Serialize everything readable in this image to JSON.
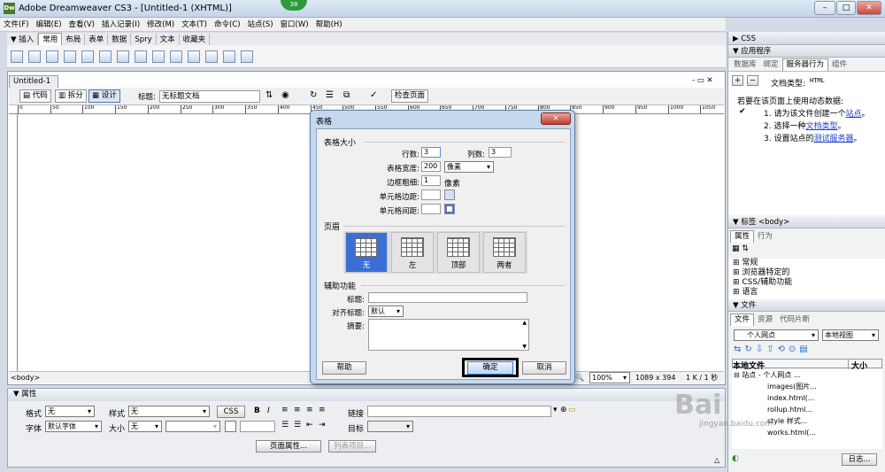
{
  "window": {
    "title": "Adobe Dreamweaver CS3 - [Untitled-1 (XHTML)]",
    "app_icon": "Dw",
    "badge": "38",
    "min_label": "–",
    "max_label": "□",
    "close_label": "✕"
  },
  "menubar": [
    "文件(F)",
    "编辑(E)",
    "查看(V)",
    "插入记录(I)",
    "修改(M)",
    "文本(T)",
    "命令(C)",
    "站点(S)",
    "窗口(W)",
    "帮助(H)"
  ],
  "insert_bar": {
    "label": "▼ 插入",
    "tabs": [
      "常用",
      "布局",
      "表单",
      "数据",
      "Spry",
      "文本",
      "收藏夹"
    ],
    "active_tab": "常用"
  },
  "document": {
    "tab_name": "Untitled-1",
    "view_code": "代码",
    "view_split": "拆分",
    "view_design": "设计",
    "title_label": "标题:",
    "title_value": "无标题文档",
    "check_page": "检查页面",
    "ruler_ticks": [
      "0",
      "50",
      "100",
      "150",
      "200",
      "250",
      "300",
      "350",
      "400",
      "450",
      "500",
      "550",
      "600",
      "650",
      "700",
      "750",
      "800",
      "850",
      "900",
      "950",
      "1000",
      "1050"
    ],
    "tag_selector": "<body>",
    "zoom": "100%",
    "size": "1089 x 394",
    "filesize": "1 K / 1 秒",
    "window_controls": "- ▭ ✕"
  },
  "properties": {
    "header": "▼ 属性",
    "format_label": "格式",
    "format_value": "无",
    "style_label": "样式",
    "style_value": "无",
    "css_btn": "CSS",
    "bold": "B",
    "italic": "I",
    "link_label": "链接",
    "font_label": "字体",
    "font_value": "默认字体",
    "size_label": "大小",
    "size_value": "无",
    "target_label": "目标",
    "page_props_btn": "页面属性...",
    "list_item_btn": "列表项目..."
  },
  "right_panel": {
    "css_header": "▶ CSS",
    "app_header": "▼ 应用程序",
    "app_tabs": [
      "数据库",
      "绑定",
      "服务器行为",
      "组件"
    ],
    "app_active": "服务器行为",
    "plus": "+",
    "minus": "−",
    "doc_type_label": "文档类型:",
    "doc_type_value": "HTML",
    "intro": "若要在该页面上使用动态数据:",
    "steps": [
      {
        "num": "1.",
        "pre": "请为该文件创建一个",
        "link": "站点",
        "post": "。"
      },
      {
        "num": "2.",
        "pre": "选择一种",
        "link": "文档类型",
        "post": "。"
      },
      {
        "num": "3.",
        "pre": "设置站点的",
        "link": "测试服务器",
        "post": "。"
      }
    ],
    "check_mark": "✔",
    "tag_header": "▼ 标签 <body>",
    "tag_tabs": [
      "属性",
      "行为"
    ],
    "tag_active": "属性",
    "attr_groups": [
      "⊞ 常规",
      "⊞ 浏览器特定的",
      "⊞ CSS/辅助功能",
      "⊞ 语言"
    ],
    "files_header": "▼ 文件",
    "files_tabs": [
      "文件",
      "资源",
      "代码片断"
    ],
    "files_active": "文件",
    "site_select": "个人网点",
    "view_select": "本地视图",
    "local_files_label": "本地文件",
    "size_col": "大小",
    "tree": [
      "⊟ 站点 - 个人网点 ...",
      "images(图片...",
      "index.html(...",
      "rollup.html...",
      "style 样式...",
      "works.html(..."
    ],
    "log_btn": "日志..."
  },
  "dialog": {
    "title": "表格",
    "close": "✕",
    "size_section": "表格大小",
    "rows_label": "行数:",
    "rows_value": "3",
    "cols_label": "列数:",
    "cols_value": "3",
    "width_label": "表格宽度:",
    "width_value": "200",
    "width_unit": "像素",
    "border_label": "边框粗细:",
    "border_value": "1",
    "border_unit": "像素",
    "padding_label": "单元格边距:",
    "spacing_label": "单元格间距:",
    "header_section": "页眉",
    "header_options": [
      "无",
      "左",
      "顶部",
      "两者"
    ],
    "header_selected": "无",
    "access_section": "辅助功能",
    "caption_label": "标题:",
    "align_caption_label": "对齐标题:",
    "align_caption_value": "默认",
    "summary_label": "摘要:",
    "help_btn": "帮助",
    "ok_btn": "确定",
    "cancel_btn": "取消"
  },
  "watermark": {
    "text": "Bai",
    "url": "jingyan.baidu.com"
  }
}
